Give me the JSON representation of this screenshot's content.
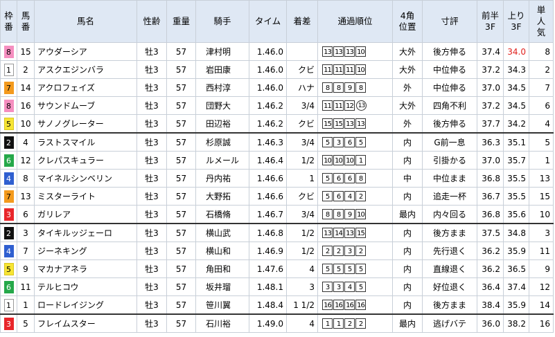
{
  "headers": {
    "waku": "枠\n番",
    "umaban": "馬\n番",
    "name": "馬名",
    "sexage": "性齢",
    "weight": "重量",
    "jockey": "騎手",
    "time": "タイム",
    "margin": "着差",
    "passing": "通過順位",
    "corner4": "4角\n位置",
    "comment": "寸評",
    "first3f": "前半\n3F",
    "last3f": "上り\n3F",
    "pop": "単\n人\n気"
  },
  "waku_colors": {
    "1": {
      "bg": "#ffffff",
      "fg": "#000000",
      "border": "#999999"
    },
    "2": {
      "bg": "#111111",
      "fg": "#ffffff",
      "border": "#111111"
    },
    "3": {
      "bg": "#e8262b",
      "fg": "#ffffff",
      "border": "#e8262b"
    },
    "4": {
      "bg": "#2f5fd0",
      "fg": "#ffffff",
      "border": "#2f5fd0"
    },
    "5": {
      "bg": "#f7e534",
      "fg": "#000000",
      "border": "#d8c520"
    },
    "6": {
      "bg": "#25a84a",
      "fg": "#ffffff",
      "border": "#25a84a"
    },
    "7": {
      "bg": "#f39a1e",
      "fg": "#000000",
      "border": "#f39a1e"
    },
    "8": {
      "bg": "#f58fc0",
      "fg": "#000000",
      "border": "#f58fc0"
    }
  },
  "rows": [
    {
      "waku": "8",
      "umaban": "15",
      "name": "アウダーシア",
      "sexage": "牡3",
      "weight": "57",
      "jockey": "津村明",
      "time": "1.46.0",
      "margin": "",
      "passing": [
        "13",
        "13",
        "13",
        "10"
      ],
      "circled": "",
      "corner4": "大外",
      "comment": "後方伸る",
      "first3f": "37.4",
      "last3f": "34.0",
      "last3f_highlight": true,
      "pop": "8",
      "sep": false
    },
    {
      "waku": "1",
      "umaban": "2",
      "name": "アスクエジンバラ",
      "sexage": "牡3",
      "weight": "57",
      "jockey": "岩田康",
      "time": "1.46.0",
      "margin": "クビ",
      "passing": [
        "11",
        "11",
        "11",
        "10"
      ],
      "circled": "",
      "corner4": "大外",
      "comment": "中位伸る",
      "first3f": "37.2",
      "last3f": "34.3",
      "pop": "2",
      "sep": false
    },
    {
      "waku": "7",
      "umaban": "14",
      "name": "アクロフェイズ",
      "sexage": "牡3",
      "weight": "57",
      "jockey": "西村淳",
      "time": "1.46.0",
      "margin": "ハナ",
      "passing": [
        "8",
        "8",
        "9",
        "8"
      ],
      "circled": "",
      "corner4": "外",
      "comment": "中位伸る",
      "first3f": "37.0",
      "last3f": "34.5",
      "pop": "7",
      "sep": false
    },
    {
      "waku": "8",
      "umaban": "16",
      "name": "サウンドムーブ",
      "sexage": "牡3",
      "weight": "57",
      "jockey": "団野大",
      "time": "1.46.2",
      "margin": "3/4",
      "passing": [
        "11",
        "11",
        "12"
      ],
      "circled": "13",
      "corner4": "大外",
      "comment": "四角不利",
      "first3f": "37.2",
      "last3f": "34.5",
      "pop": "6",
      "sep": false
    },
    {
      "waku": "5",
      "umaban": "10",
      "name": "サノノグレーター",
      "sexage": "牡3",
      "weight": "57",
      "jockey": "田辺裕",
      "time": "1.46.2",
      "margin": "クビ",
      "passing": [
        "15",
        "15",
        "13",
        "13"
      ],
      "circled": "",
      "corner4": "外",
      "comment": "後方伸る",
      "first3f": "37.7",
      "last3f": "34.2",
      "pop": "4",
      "sep": false
    },
    {
      "waku": "2",
      "umaban": "4",
      "name": "ラストスマイル",
      "sexage": "牡3",
      "weight": "57",
      "jockey": "杉原誠",
      "time": "1.46.3",
      "margin": "3/4",
      "passing": [
        "5",
        "3",
        "6",
        "5"
      ],
      "circled": "",
      "corner4": "内",
      "comment": "G前一息",
      "first3f": "36.3",
      "last3f": "35.1",
      "pop": "5",
      "sep": true
    },
    {
      "waku": "6",
      "umaban": "12",
      "name": "クレパスキュラー",
      "sexage": "牡3",
      "weight": "57",
      "jockey": "ルメール",
      "time": "1.46.4",
      "margin": "1/2",
      "passing": [
        "10",
        "10",
        "10",
        "1"
      ],
      "circled": "",
      "corner4": "内",
      "comment": "引掛かる",
      "first3f": "37.0",
      "last3f": "35.7",
      "pop": "1",
      "sep": false
    },
    {
      "waku": "4",
      "umaban": "8",
      "name": "マイネルシンベリン",
      "sexage": "牡3",
      "weight": "57",
      "jockey": "丹内祐",
      "time": "1.46.6",
      "margin": "1",
      "passing": [
        "5",
        "6",
        "6",
        "8"
      ],
      "circled": "",
      "corner4": "中",
      "comment": "中位まま",
      "first3f": "36.8",
      "last3f": "35.5",
      "pop": "13",
      "sep": false
    },
    {
      "waku": "7",
      "umaban": "13",
      "name": "ミスターライト",
      "sexage": "牡3",
      "weight": "57",
      "jockey": "大野拓",
      "time": "1.46.6",
      "margin": "クビ",
      "passing": [
        "5",
        "6",
        "4",
        "2"
      ],
      "circled": "",
      "corner4": "内",
      "comment": "追走一杯",
      "first3f": "36.7",
      "last3f": "35.5",
      "pop": "15",
      "sep": false
    },
    {
      "waku": "3",
      "umaban": "6",
      "name": "ガリレア",
      "sexage": "牡3",
      "weight": "57",
      "jockey": "石橋脩",
      "time": "1.46.7",
      "margin": "3/4",
      "passing": [
        "8",
        "8",
        "9",
        "10"
      ],
      "circled": "",
      "corner4": "最内",
      "comment": "内々回る",
      "first3f": "36.8",
      "last3f": "35.6",
      "pop": "10",
      "sep": false
    },
    {
      "waku": "2",
      "umaban": "3",
      "name": "タイキルッジェーロ",
      "sexage": "牡3",
      "weight": "57",
      "jockey": "横山武",
      "time": "1.46.8",
      "margin": "1/2",
      "passing": [
        "13",
        "14",
        "13",
        "15"
      ],
      "circled": "",
      "corner4": "内",
      "comment": "後方まま",
      "first3f": "37.5",
      "last3f": "34.8",
      "pop": "3",
      "sep": true
    },
    {
      "waku": "4",
      "umaban": "7",
      "name": "ジーネキング",
      "sexage": "牡3",
      "weight": "57",
      "jockey": "横山和",
      "time": "1.46.9",
      "margin": "1/2",
      "passing": [
        "2",
        "2",
        "3",
        "2"
      ],
      "circled": "",
      "corner4": "内",
      "comment": "先行退く",
      "first3f": "36.2",
      "last3f": "35.9",
      "pop": "11",
      "sep": false
    },
    {
      "waku": "5",
      "umaban": "9",
      "name": "マカナアネラ",
      "sexage": "牡3",
      "weight": "57",
      "jockey": "角田和",
      "time": "1.47.6",
      "margin": "4",
      "passing": [
        "5",
        "5",
        "5",
        "5"
      ],
      "circled": "",
      "corner4": "内",
      "comment": "直線退く",
      "first3f": "36.2",
      "last3f": "36.5",
      "pop": "9",
      "sep": false
    },
    {
      "waku": "6",
      "umaban": "11",
      "name": "テルヒコウ",
      "sexage": "牡3",
      "weight": "57",
      "jockey": "坂井瑠",
      "time": "1.48.1",
      "margin": "3",
      "passing": [
        "3",
        "3",
        "4",
        "5"
      ],
      "circled": "",
      "corner4": "内",
      "comment": "好位退く",
      "first3f": "36.4",
      "last3f": "37.4",
      "pop": "12",
      "sep": false
    },
    {
      "waku": "1",
      "umaban": "1",
      "name": "ロードレイジング",
      "sexage": "牡3",
      "weight": "57",
      "jockey": "笹川翼",
      "time": "1.48.4",
      "margin": "1 1/2",
      "passing": [
        "16",
        "16",
        "16",
        "16"
      ],
      "circled": "",
      "corner4": "内",
      "comment": "後方まま",
      "first3f": "38.4",
      "last3f": "35.9",
      "pop": "14",
      "sep": false
    },
    {
      "waku": "3",
      "umaban": "5",
      "name": "フレイムスター",
      "sexage": "牡3",
      "weight": "57",
      "jockey": "石川裕",
      "time": "1.49.0",
      "margin": "4",
      "passing": [
        "1",
        "1",
        "2",
        "2"
      ],
      "circled": "",
      "corner4": "最内",
      "comment": "逃げバテ",
      "first3f": "36.0",
      "last3f": "38.2",
      "pop": "16",
      "sep": true
    }
  ]
}
